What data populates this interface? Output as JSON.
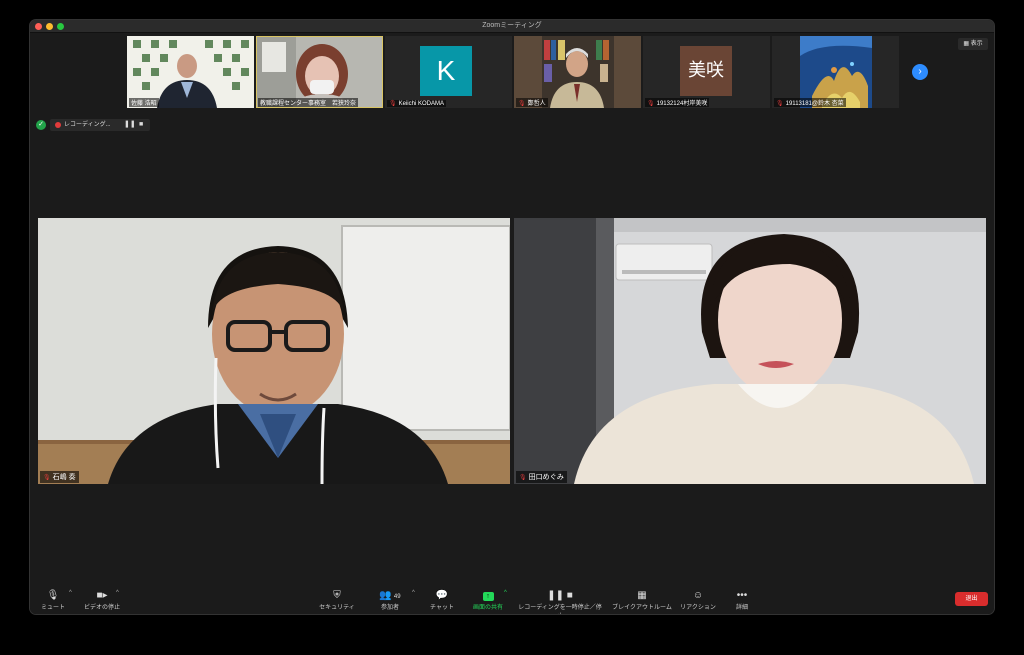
{
  "window": {
    "title": "Zoomミーティング"
  },
  "gallery": {
    "participants": [
      {
        "name": "佐藤 浩昭",
        "muted": false
      },
      {
        "name": "教職課程センター事務室　若狭玲奈",
        "muted": false,
        "active": true
      },
      {
        "name": "Keiichi KODAMA",
        "muted": true,
        "avatar": "K"
      },
      {
        "name": "鄭哲人",
        "muted": true
      },
      {
        "name": "19132124村岸美咲",
        "muted": true,
        "avatar": "美咲"
      },
      {
        "name": "19113181@鈴木 杏菜",
        "muted": true
      }
    ],
    "next_icon": "chevron-right-icon",
    "view_label": "表示"
  },
  "recording": {
    "label": "レコーディング..."
  },
  "speakers": [
    {
      "name": "石嶋 奏",
      "muted": true
    },
    {
      "name": "田口めぐみ",
      "muted": true
    }
  ],
  "toolbar": {
    "mute": "ミュート",
    "stop_video": "ビデオの停止",
    "security": "セキュリティ",
    "participants": "参加者",
    "participants_count": "49",
    "chat": "チャット",
    "share": "画面の共有",
    "recording": "レコーディングを一時停止／停止",
    "breakout": "ブレイクアウトルーム",
    "reactions": "リアクション",
    "more": "詳細",
    "leave": "退出"
  },
  "colors": {
    "share_green": "#23d959",
    "leave_red": "#d92d2d",
    "muted_red": "#e23b3b",
    "accent_blue": "#2d8cff",
    "active_outline": "#d8c463"
  }
}
